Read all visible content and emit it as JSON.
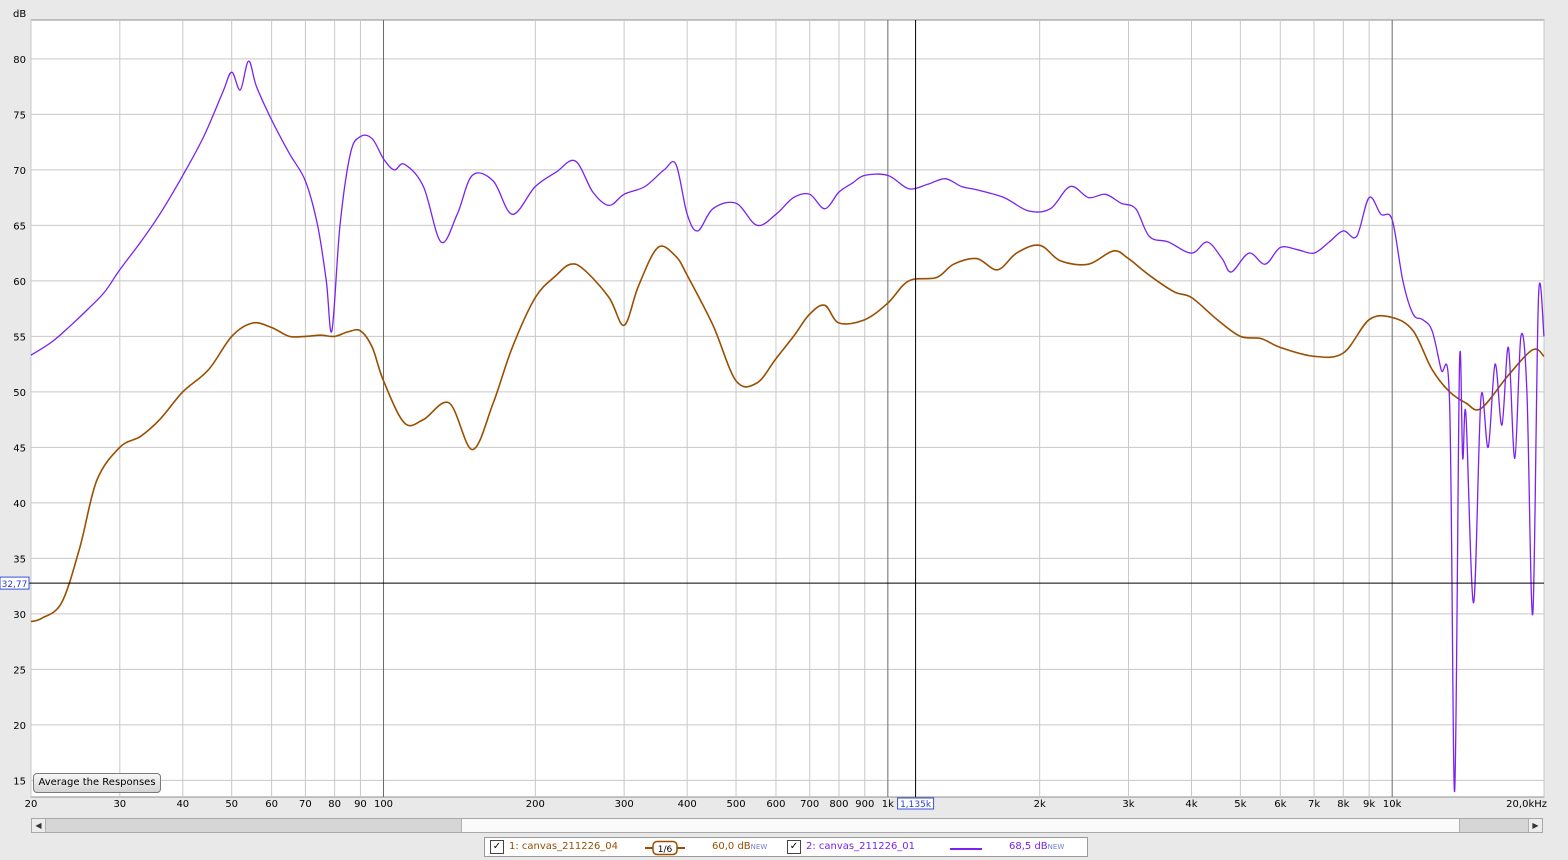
{
  "chart_data": {
    "type": "line",
    "ylabel": "dB",
    "x_scale": "log",
    "xlim": [
      20,
      20000
    ],
    "ylim": [
      13.5,
      83.5
    ],
    "y_ticks": [
      15,
      20,
      25,
      30,
      35,
      40,
      45,
      50,
      55,
      60,
      65,
      70,
      75,
      80
    ],
    "x_ticks": [
      {
        "v": 20,
        "label": "20"
      },
      {
        "v": 30,
        "label": "30"
      },
      {
        "v": 40,
        "label": "40"
      },
      {
        "v": 50,
        "label": "50"
      },
      {
        "v": 60,
        "label": "60"
      },
      {
        "v": 70,
        "label": "70"
      },
      {
        "v": 80,
        "label": "80"
      },
      {
        "v": 90,
        "label": "90"
      },
      {
        "v": 100,
        "label": "100"
      },
      {
        "v": 200,
        "label": "200"
      },
      {
        "v": 300,
        "label": "300"
      },
      {
        "v": 400,
        "label": "400"
      },
      {
        "v": 500,
        "label": "500"
      },
      {
        "v": 600,
        "label": "600"
      },
      {
        "v": 700,
        "label": "700"
      },
      {
        "v": 800,
        "label": "800"
      },
      {
        "v": 900,
        "label": "900"
      },
      {
        "v": 1000,
        "label": "1k"
      },
      {
        "v": 2000,
        "label": "2k"
      },
      {
        "v": 3000,
        "label": "3k"
      },
      {
        "v": 4000,
        "label": "4k"
      },
      {
        "v": 5000,
        "label": "5k"
      },
      {
        "v": 6000,
        "label": "6k"
      },
      {
        "v": 7000,
        "label": "7k"
      },
      {
        "v": 8000,
        "label": "8k"
      },
      {
        "v": 9000,
        "label": "9k"
      },
      {
        "v": 10000,
        "label": "10k"
      },
      {
        "v": 20000,
        "label": "20,0kHz"
      }
    ],
    "grid": true,
    "cursor": {
      "x": 1135,
      "x_label": "1,135k",
      "y": 32.77,
      "y_label": "32,77"
    },
    "series": [
      {
        "name": "1: canvas_211226_04",
        "color": "#9a4e00",
        "x": [
          20,
          21,
          23,
          25,
          27,
          30,
          33,
          36,
          40,
          45,
          50,
          55,
          60,
          65,
          70,
          75,
          80,
          85,
          90,
          95,
          100,
          110,
          120,
          135,
          150,
          165,
          180,
          200,
          220,
          235,
          250,
          280,
          300,
          320,
          350,
          380,
          400,
          450,
          500,
          550,
          600,
          650,
          700,
          750,
          800,
          900,
          1000,
          1100,
          1250,
          1350,
          1500,
          1650,
          1800,
          2000,
          2200,
          2500,
          2800,
          3000,
          3300,
          3700,
          4000,
          4500,
          5000,
          5500,
          6000,
          7000,
          8000,
          9000,
          10000,
          11000,
          12000,
          13000,
          14000,
          15000,
          17000,
          19000,
          20000
        ],
        "y": [
          29.3,
          29.6,
          31.0,
          36.0,
          42.0,
          45.0,
          46.0,
          47.5,
          50.0,
          52.0,
          55.0,
          56.2,
          55.8,
          55.0,
          55.0,
          55.1,
          55.0,
          55.4,
          55.5,
          54.0,
          51.0,
          47.2,
          47.5,
          49.0,
          44.8,
          49.0,
          54.0,
          58.5,
          60.5,
          61.5,
          61.0,
          58.5,
          56.0,
          59.5,
          63.0,
          62.2,
          60.5,
          56.0,
          51.0,
          50.8,
          53.0,
          55.0,
          57.0,
          57.8,
          56.2,
          56.5,
          58.0,
          60.0,
          60.3,
          61.5,
          62.0,
          61.0,
          62.5,
          63.2,
          61.8,
          61.5,
          62.7,
          62.0,
          60.5,
          59.0,
          58.5,
          56.5,
          55.0,
          54.8,
          54.0,
          53.2,
          53.5,
          56.5,
          56.7,
          55.5,
          52.0,
          50.0,
          49.0,
          48.5,
          51.5,
          53.8,
          53.2
        ]
      },
      {
        "name": "2: canvas_211226_01",
        "color": "#7a22f0",
        "x": [
          20,
          22,
          24,
          26,
          28,
          30,
          33,
          36,
          40,
          44,
          48,
          50,
          52,
          54,
          56,
          60,
          65,
          70,
          74,
          77,
          79,
          82,
          86,
          90,
          95,
          100,
          105,
          110,
          120,
          130,
          140,
          150,
          165,
          180,
          200,
          220,
          240,
          260,
          280,
          300,
          330,
          360,
          380,
          400,
          420,
          450,
          500,
          550,
          600,
          650,
          700,
          750,
          800,
          850,
          900,
          1000,
          1100,
          1200,
          1300,
          1400,
          1500,
          1700,
          1900,
          2100,
          2300,
          2500,
          2700,
          2900,
          3100,
          3300,
          3600,
          4000,
          4300,
          4600,
          4800,
          5200,
          5600,
          6000,
          6500,
          7000,
          7500,
          8000,
          8500,
          9000,
          9500,
          10000,
          10500,
          11000,
          11500,
          12000,
          12500,
          13000,
          13300,
          13600,
          13800,
          14000,
          14500,
          15000,
          15500,
          16000,
          16500,
          17000,
          17500,
          18000,
          18500,
          19000,
          19500,
          20000
        ],
        "y": [
          53.3,
          54.5,
          56.0,
          57.5,
          59.0,
          61.0,
          63.5,
          66.0,
          69.5,
          73.0,
          77.0,
          78.8,
          77.2,
          79.8,
          77.5,
          74.5,
          71.5,
          69.0,
          65.0,
          60.0,
          55.5,
          65.0,
          71.5,
          73.0,
          72.8,
          71.0,
          70.0,
          70.5,
          68.5,
          63.5,
          66.0,
          69.5,
          69.0,
          66.0,
          68.5,
          69.8,
          70.8,
          68.0,
          66.8,
          67.8,
          68.5,
          70.0,
          70.5,
          66.0,
          64.5,
          66.5,
          67.0,
          65.0,
          66.0,
          67.5,
          67.8,
          66.5,
          68.0,
          68.8,
          69.5,
          69.5,
          68.3,
          68.7,
          69.2,
          68.5,
          68.2,
          67.5,
          66.3,
          66.5,
          68.5,
          67.5,
          67.8,
          67.0,
          66.5,
          64.0,
          63.5,
          62.5,
          63.5,
          62.0,
          60.8,
          62.5,
          61.5,
          63.0,
          62.8,
          62.5,
          63.5,
          64.5,
          64.0,
          67.5,
          66.0,
          65.5,
          60.0,
          57.0,
          56.5,
          55.5,
          52.0,
          49.0,
          14.0,
          52.5,
          44.0,
          48.0,
          31.0,
          49.5,
          45.0,
          52.5,
          47.0,
          54.0,
          44.0,
          55.0,
          50.0,
          30.0,
          58.5,
          55.0
        ]
      }
    ]
  },
  "button": {
    "average": "Average the Responses"
  },
  "legend": {
    "item1": {
      "label": "1: canvas_211226_04",
      "smoothing": "1/6",
      "level": "60,0 dB",
      "tag": "NEW",
      "color": "#9a4e00"
    },
    "item2": {
      "label": "2: canvas_211226_01",
      "level": "68,5 dB",
      "tag": "NEW",
      "color": "#7a22f0"
    }
  },
  "scrollbar": {
    "left_arrow": "◀",
    "right_arrow": "▶"
  }
}
